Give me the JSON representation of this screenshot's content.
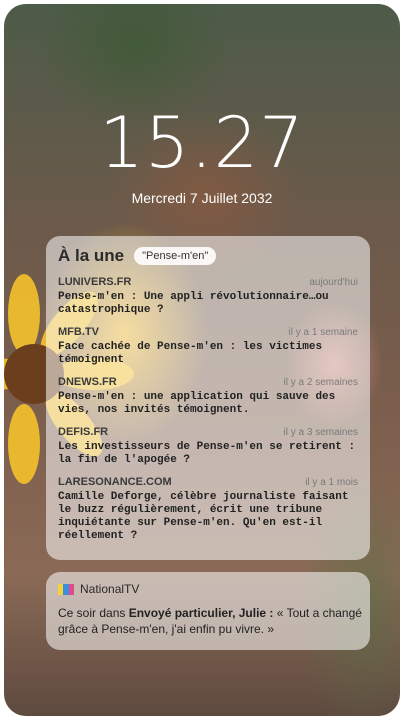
{
  "lockscreen": {
    "time": "15.27",
    "date": "Mercredi 7 Juillet 2032"
  },
  "news_widget": {
    "title": "À la une",
    "tag": "\"Pense-m'en\"",
    "items": [
      {
        "source": "LUNIVERS.FR",
        "time": "aujourd'hui",
        "headline": "Pense-m'en : Une appli révolutionnaire…ou catastrophique ?"
      },
      {
        "source": "MFB.TV",
        "time": "il y a 1 semaine",
        "headline": "Face cachée de Pense-m'en : les victimes témoignent"
      },
      {
        "source": "DNEWS.FR",
        "time": "il y a 2 semaines",
        "headline": "Pense-m'en : une application qui sauve des vies, nos invités témoignent."
      },
      {
        "source": "DEFIS.FR",
        "time": "il y a 3 semaines",
        "headline": "Les investisseurs de Pense-m'en se retirent : la fin de l'apogée ?"
      },
      {
        "source": "LARESONANCE.COM",
        "time": "il y a 1 mois",
        "headline": "Camille Deforge, célèbre journaliste faisant le buzz régulièrement, écrit une tribune inquiétante sur Pense-m'en. Qu'en est-il réellement ?"
      }
    ]
  },
  "tv_notification": {
    "name": "NationalTV",
    "icon": "tv-color-bars-icon",
    "text_prefix": "Ce soir dans ",
    "text_bold": "Envoyé particulier, Julie :",
    "text_suffix": " « Tout a changé grâce à Pense-m'en, j'ai enfin pu vivre. »",
    "colors": {
      "bar1": "#f2d33a",
      "bar2": "#3a8fe0",
      "bar3": "#e04a8a"
    }
  }
}
